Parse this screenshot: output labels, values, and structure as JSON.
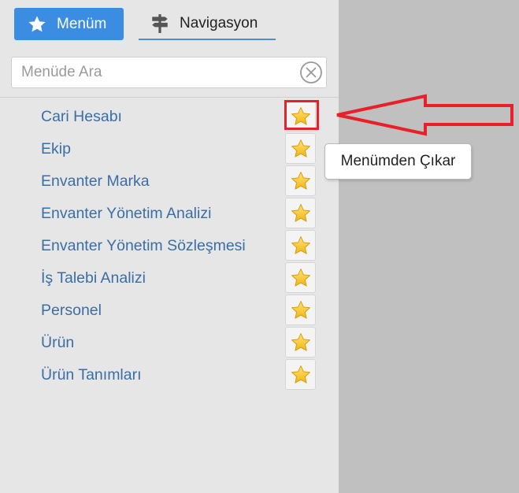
{
  "tabs": {
    "menum_label": "Menüm",
    "navigasyon_label": "Navigasyon"
  },
  "search": {
    "placeholder": "Menüde Ara",
    "value": ""
  },
  "menu_items": [
    {
      "label": "Cari Hesabı",
      "favorite": true
    },
    {
      "label": "Ekip",
      "favorite": true
    },
    {
      "label": "Envanter Marka",
      "favorite": true
    },
    {
      "label": "Envanter Yönetim Analizi",
      "favorite": true
    },
    {
      "label": "Envanter Yönetim Sözleşmesi",
      "favorite": true
    },
    {
      "label": "İş Talebi Analizi",
      "favorite": true
    },
    {
      "label": "Personel",
      "favorite": true
    },
    {
      "label": "Ürün",
      "favorite": true
    },
    {
      "label": "Ürün Tanımları",
      "favorite": true
    }
  ],
  "tooltip": {
    "text": "Menümden Çıkar"
  },
  "colors": {
    "accent": "#3a8de0",
    "link": "#3a6ea5",
    "highlight": "#e8202a",
    "star_fill": "#f7c325"
  },
  "icons": [
    "star-icon",
    "signpost-icon",
    "clear-icon",
    "favorite-star-icon",
    "pointer-arrow"
  ]
}
